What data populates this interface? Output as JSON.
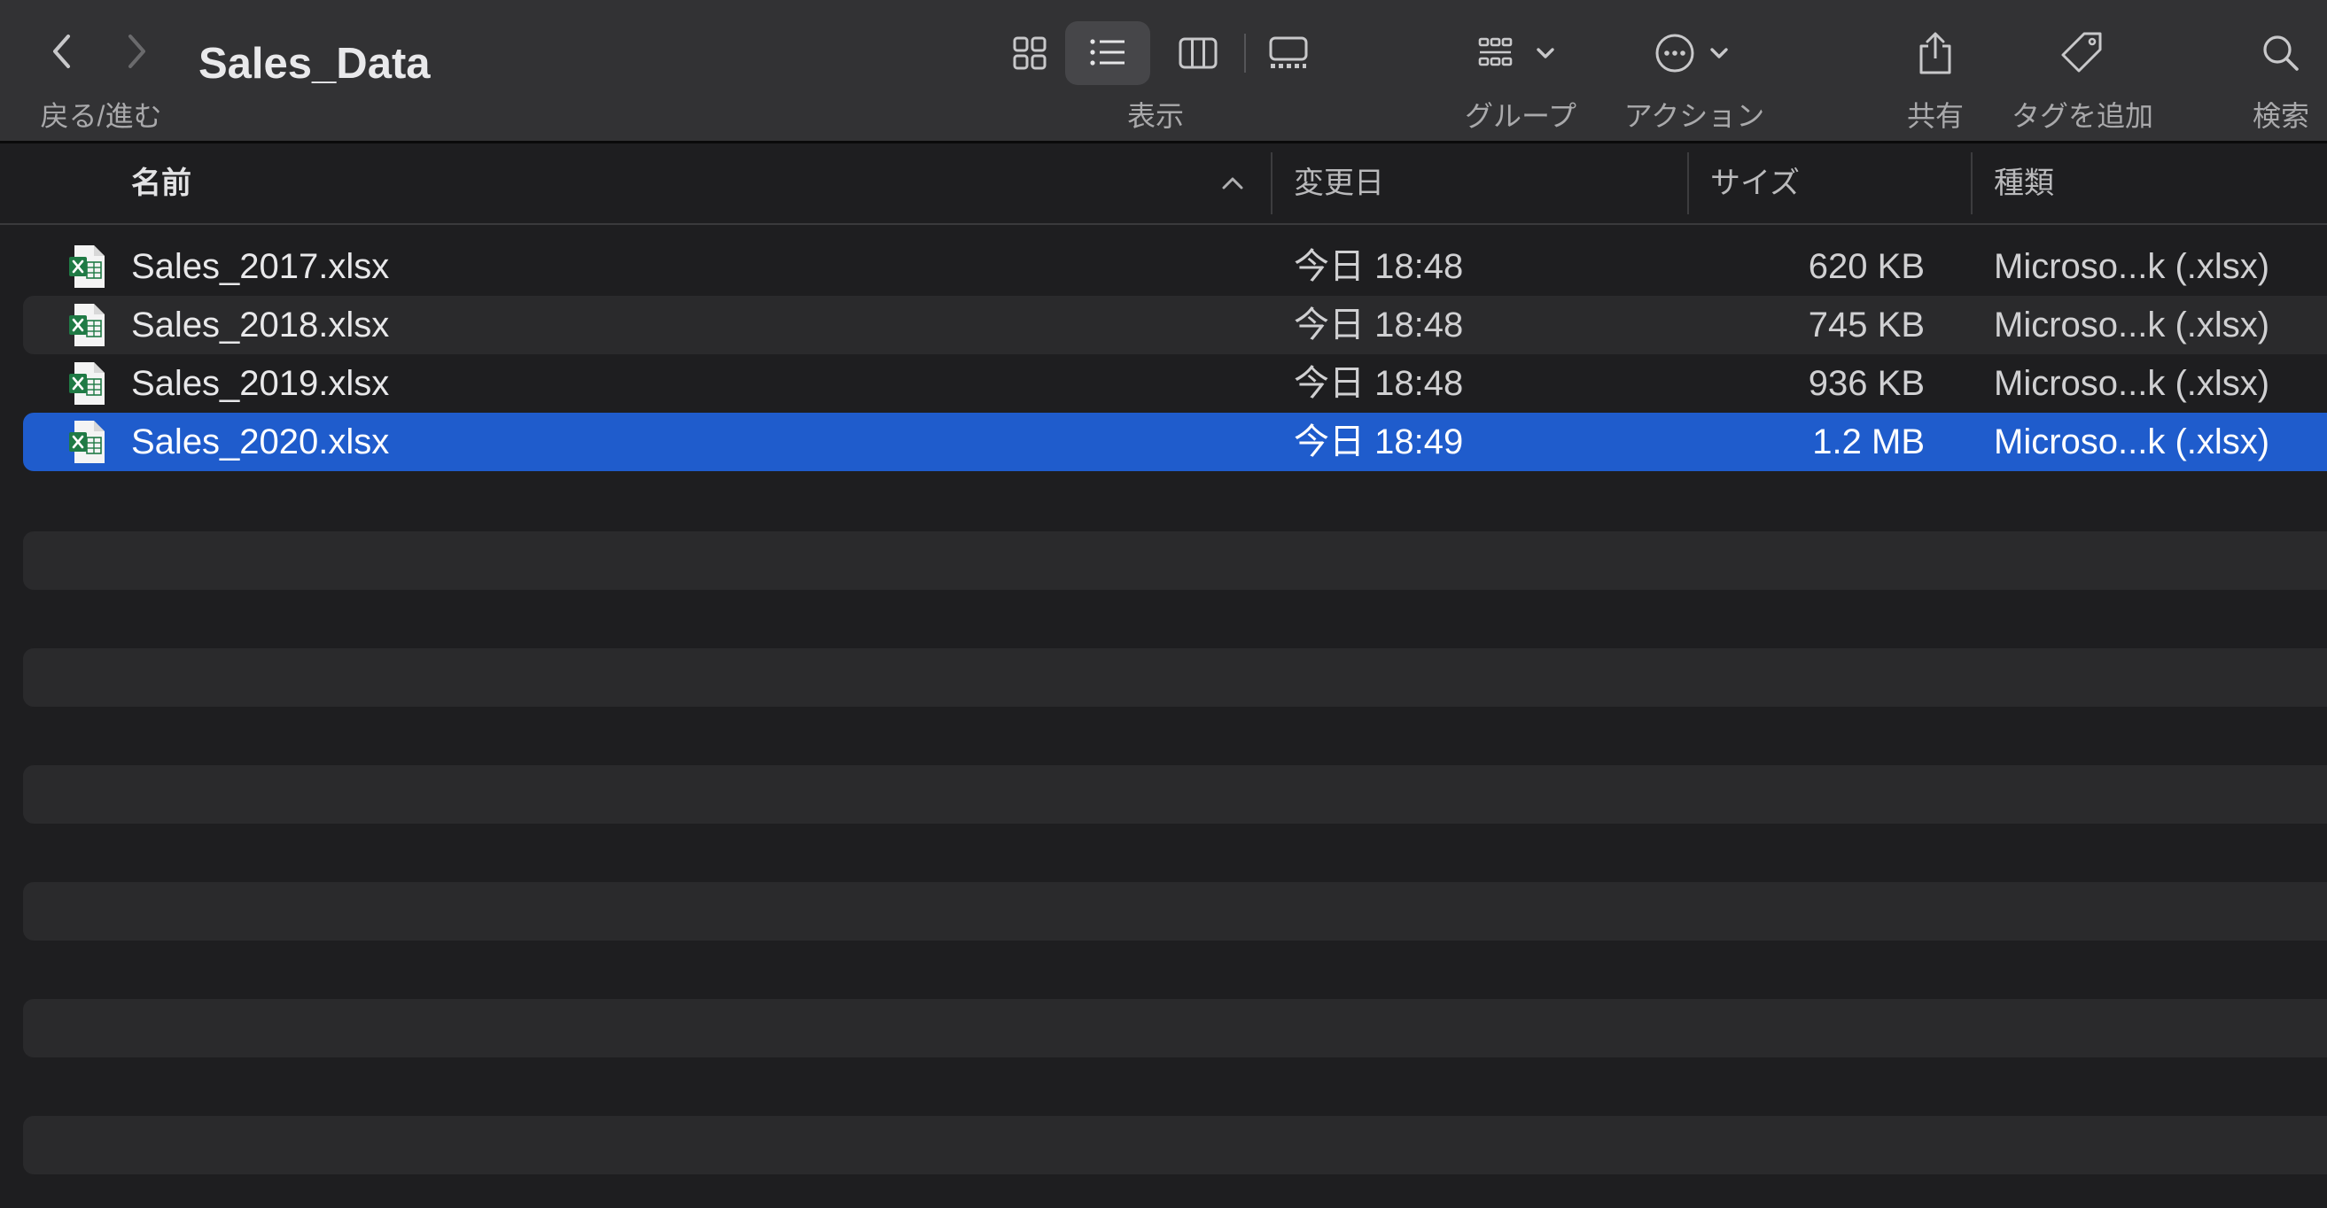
{
  "toolbar": {
    "title": "Sales_Data",
    "nav_label": "戻る/進む",
    "view_label": "表示",
    "group_label": "グループ",
    "action_label": "アクション",
    "share_label": "共有",
    "tag_label": "タグを追加",
    "search_label": "検索",
    "active_view": "list"
  },
  "columns": {
    "name": "名前",
    "date": "変更日",
    "size": "サイズ",
    "kind": "種類",
    "sort": "ascending"
  },
  "files": [
    {
      "name": "Sales_2017.xlsx",
      "date": "今日 18:48",
      "size": "620 KB",
      "kind": "Microso...k (.xlsx)",
      "selected": false
    },
    {
      "name": "Sales_2018.xlsx",
      "date": "今日 18:48",
      "size": "745 KB",
      "kind": "Microso...k (.xlsx)",
      "selected": false
    },
    {
      "name": "Sales_2019.xlsx",
      "date": "今日 18:48",
      "size": "936 KB",
      "kind": "Microso...k (.xlsx)",
      "selected": false
    },
    {
      "name": "Sales_2020.xlsx",
      "date": "今日 18:49",
      "size": "1.2 MB",
      "kind": "Microso...k (.xlsx)",
      "selected": true
    }
  ],
  "colors": {
    "selection": "#1f5ccc",
    "toolbar_bg": "#323234",
    "window_bg": "#1e1e20",
    "excel_green": "#1f7a45"
  }
}
